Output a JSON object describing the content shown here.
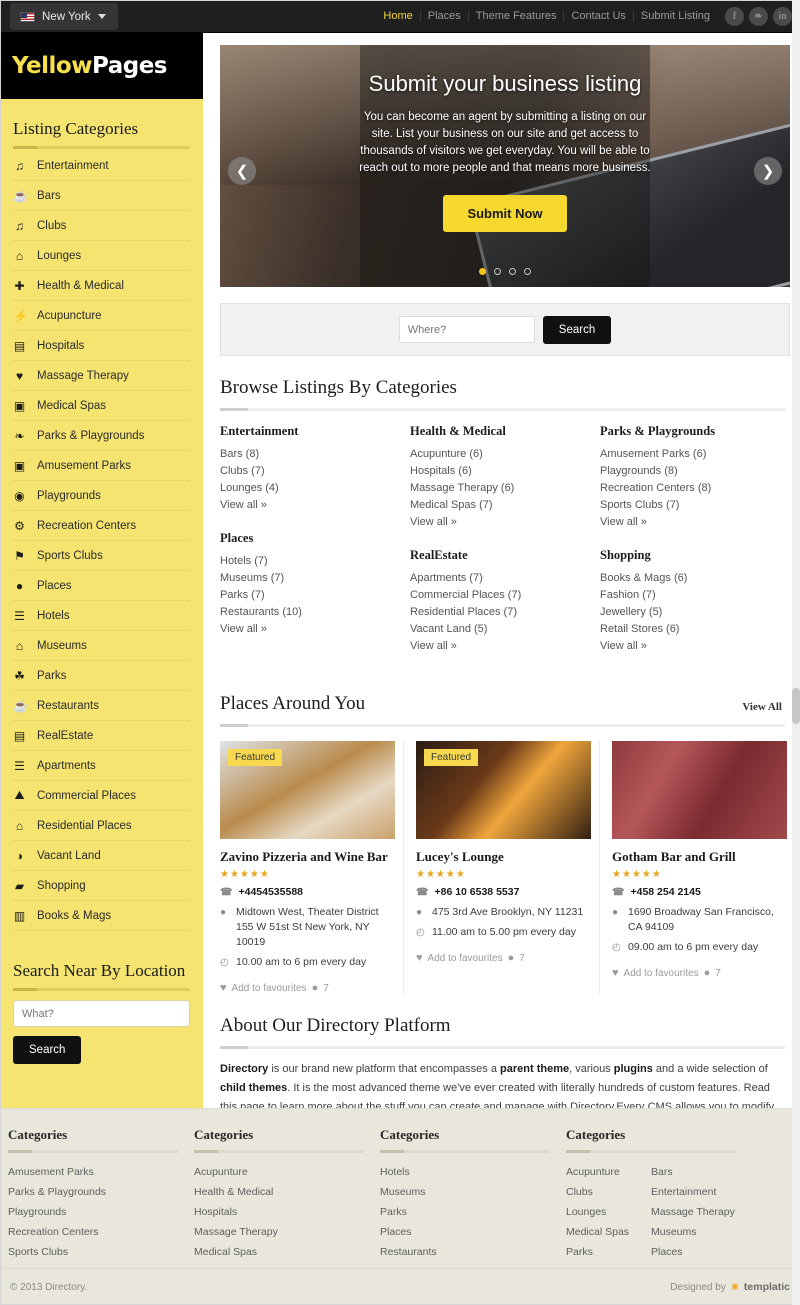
{
  "topbar": {
    "city": "New York",
    "flag_icon": "us-flag-icon",
    "nav": [
      {
        "label": "Home",
        "active": true
      },
      {
        "label": "Places",
        "active": false
      },
      {
        "label": "Theme Features",
        "active": false
      },
      {
        "label": "Contact Us",
        "active": false
      },
      {
        "label": "Submit Listing",
        "active": false
      }
    ],
    "social": [
      {
        "name": "facebook-icon",
        "glyph": "f"
      },
      {
        "name": "twitter-icon",
        "glyph": "❧"
      },
      {
        "name": "linkedin-icon",
        "glyph": "in"
      }
    ]
  },
  "logo": {
    "part1": "Yellow",
    "part2": "Pages"
  },
  "sidebar": {
    "title": "Listing Categories",
    "items": [
      {
        "label": "Entertainment",
        "icon": "music-note-icon",
        "glyph": "♫"
      },
      {
        "label": "Bars",
        "icon": "cocktail-glass-icon",
        "glyph": "ᴬ"
      },
      {
        "label": "Clubs",
        "icon": "music-note-icon",
        "glyph": "♫"
      },
      {
        "label": "Lounges",
        "icon": "home-icon",
        "glyph": "⌂"
      },
      {
        "label": "Health & Medical",
        "icon": "medical-cross-icon",
        "glyph": "✚"
      },
      {
        "label": "Acupuncture",
        "icon": "bolt-icon",
        "glyph": "⚡"
      },
      {
        "label": "Hospitals",
        "icon": "clipboard-icon",
        "glyph": "ὌB"
      },
      {
        "label": "Massage Therapy",
        "icon": "heart-pin-icon",
        "glyph": "♥"
      },
      {
        "label": "Medical Spas",
        "icon": "briefcase-medical-icon",
        "glyph": "ὋC"
      },
      {
        "label": "Parks & Playgrounds",
        "icon": "leaf-icon",
        "glyph": "❦"
      },
      {
        "label": "Amusement Parks",
        "icon": "picture-icon",
        "glyph": "▣"
      },
      {
        "label": "Playgrounds",
        "icon": "target-icon",
        "glyph": "◉"
      },
      {
        "label": "Recreation Centers",
        "icon": "gears-icon",
        "glyph": "⚙"
      },
      {
        "label": "Sports Clubs",
        "icon": "flag-icon",
        "glyph": "⚑"
      },
      {
        "label": "Places",
        "icon": "map-pin-icon",
        "glyph": "●"
      },
      {
        "label": "Hotels",
        "icon": "list-icon",
        "glyph": "☰"
      },
      {
        "label": "Museums",
        "icon": "home-icon",
        "glyph": "⌂"
      },
      {
        "label": "Parks",
        "icon": "tree-icon",
        "glyph": "☘"
      },
      {
        "label": "Restaurants",
        "icon": "cocktail-glass-icon",
        "glyph": "ᴬ"
      },
      {
        "label": "RealEstate",
        "icon": "building-icon",
        "glyph": "▤"
      },
      {
        "label": "Apartments",
        "icon": "list-icon",
        "glyph": "☰"
      },
      {
        "label": "Commercial Places",
        "icon": "bridge-icon",
        "glyph": "ᴀ"
      },
      {
        "label": "Residential Places",
        "icon": "home-icon",
        "glyph": "⌂"
      },
      {
        "label": "Vacant Land",
        "icon": "globe-icon",
        "glyph": "◑"
      },
      {
        "label": "Shopping",
        "icon": "shopping-cart-icon",
        "glyph": "Ὥ2"
      },
      {
        "label": "Books & Mags",
        "icon": "book-icon",
        "glyph": "Ὅ5"
      }
    ],
    "search_near": {
      "title": "Search Near By Location",
      "placeholder": "What?",
      "button": "Search"
    }
  },
  "hero": {
    "title": "Submit your business listing",
    "subtitle": "You can become an agent by submitting a listing on our site. List your business on our site and get access to thousands of visitors we get everyday. You will be able to reach out to more people and that means more business.",
    "button": "Submit Now",
    "prev_icon": "chevron-left-icon",
    "next_icon": "chevron-right-icon",
    "slides": 4,
    "active_slide": 1
  },
  "search_strip": {
    "placeholder": "Where?",
    "button": "Search"
  },
  "browse": {
    "heading": "Browse Listings By Categories",
    "view_all_label": "View all »",
    "columns": [
      [
        {
          "title": "Entertainment",
          "links": [
            "Bars (8)",
            "Clubs (7)",
            "Lounges (4)"
          ]
        },
        {
          "title": "Places",
          "links": [
            "Hotels (7)",
            "Museums (7)",
            "Parks (7)",
            "Restaurants (10)"
          ]
        }
      ],
      [
        {
          "title": "Health & Medical",
          "links": [
            "Acupunture (6)",
            "Hospitals (6)",
            "Massage Therapy (6)",
            "Medical Spas (7)"
          ]
        },
        {
          "title": "RealEstate",
          "links": [
            "Apartments (7)",
            "Commercial Places (7)",
            "Residential Places (7)",
            "Vacant Land (5)"
          ]
        }
      ],
      [
        {
          "title": "Parks & Playgrounds",
          "links": [
            "Amusement Parks (6)",
            "Playgrounds (8)",
            "Recreation Centers (8)",
            "Sports Clubs (7)"
          ]
        },
        {
          "title": "Shopping",
          "links": [
            "Books & Mags (6)",
            "Fashion (7)",
            "Jewellery (5)",
            "Retail Stores (6)"
          ]
        }
      ]
    ]
  },
  "places": {
    "heading": "Places Around You",
    "view_all": "View All",
    "featured_label": "Featured",
    "favourite_label": "Add to favourites",
    "cards": [
      {
        "name": "Zavino Pizzeria and Wine Bar",
        "stars": "★★★★★",
        "phone": "+4454535588",
        "address": "Midtown West, Theater District 155 W 51st St New York, NY 10019",
        "hours": "10.00 am to 6 pm every day",
        "comments": "7",
        "featured": true,
        "image": "food-jars-photo"
      },
      {
        "name": "Lucey's Lounge",
        "stars": "★★★★★",
        "phone": "+86 10 6538 5537",
        "address": "475 3rd Ave Brooklyn, NY 11231",
        "hours": "11.00 am to 5.00 pm every day",
        "comments": "7",
        "featured": true,
        "image": "lounge-interior-photo"
      },
      {
        "name": "Gotham Bar and Grill",
        "stars": "★★★★★",
        "phone": "+458 254 2145",
        "address": "1690 Broadway San Francisco, CA 94109",
        "hours": "09.00 am to 6 pm every day",
        "comments": "7",
        "featured": false,
        "image": "red-booth-photo"
      }
    ]
  },
  "about": {
    "heading": "About Our Directory Platform",
    "paragraph_parts": [
      {
        "text": "Directory",
        "bold": true
      },
      {
        "text": " is our brand new platform that encompasses a ",
        "bold": false
      },
      {
        "text": "parent theme",
        "bold": true
      },
      {
        "text": ", various ",
        "bold": false
      },
      {
        "text": "plugins",
        "bold": true
      },
      {
        "text": " and a wide selection of ",
        "bold": false
      },
      {
        "text": "child themes",
        "bold": true
      },
      {
        "text": ". It is the most advanced theme we've ever created with literally hundreds of custom features. Read this page to learn more about the stuff you can create and manage with Directory.Every CMS allows you to modify and publish content, but not many give visitors the",
        "bold": false
      }
    ]
  },
  "footer": {
    "columns": [
      {
        "title": "Categories",
        "lists": [
          [
            "Amusement Parks",
            "Parks & Playgrounds",
            "Playgrounds",
            "Recreation Centers",
            "Sports Clubs"
          ]
        ]
      },
      {
        "title": "Categories",
        "lists": [
          [
            "Acupunture",
            "Health & Medical",
            "Hospitals",
            "Massage Therapy",
            "Medical Spas"
          ]
        ]
      },
      {
        "title": "Categories",
        "lists": [
          [
            "Hotels",
            "Museums",
            "Parks",
            "Places",
            "Restaurants"
          ]
        ]
      },
      {
        "title": "Categories",
        "lists": [
          [
            "Acupunture",
            "Clubs",
            "Lounges",
            "Medical Spas",
            "Parks"
          ],
          [
            "Bars",
            "Entertainment",
            "Massage Therapy",
            "Museums",
            "Places"
          ]
        ]
      }
    ],
    "copyright": "© 2013 Directory.",
    "designed_by": "Designed by",
    "designer": "templatic"
  }
}
